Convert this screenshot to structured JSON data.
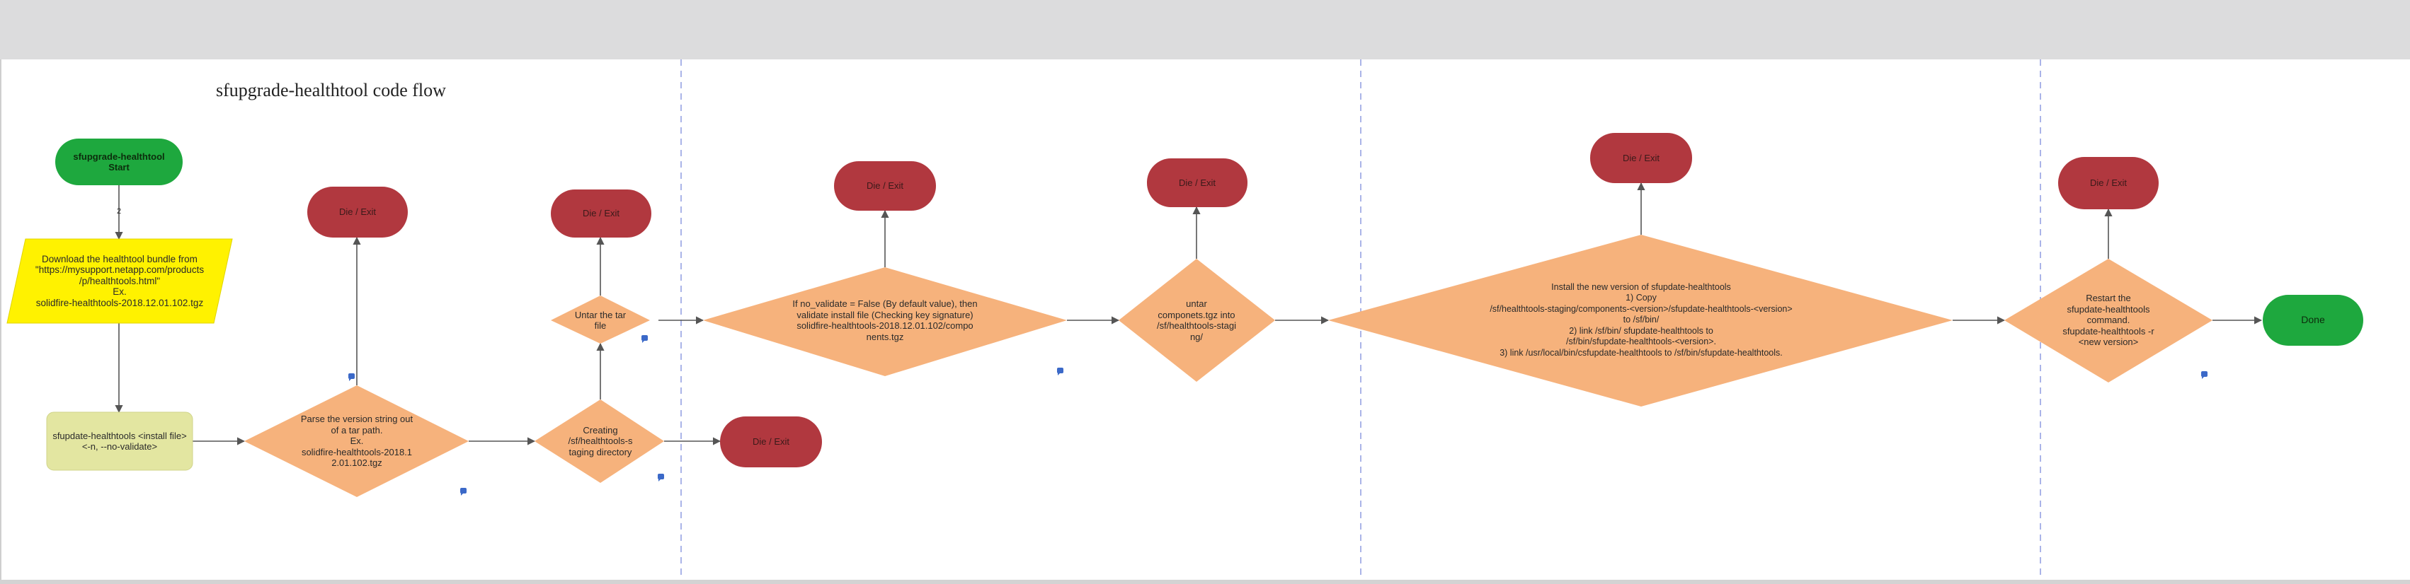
{
  "diagram": {
    "title": "sfupgrade-healthtool code flow",
    "start_label": "sfupgrade-healthtool\nStart",
    "edge_label": "2",
    "download_label": "Download the healthtool bundle from\n\"https://mysupport.netapp.com/products\n/p/healthtools.html\"\nEx.\nsolidfire-healthtools-2018.12.01.102.tgz",
    "install_cmd_label": "sfupdate-healthtools <install file>\n<-n, --no-validate>",
    "parse_label": "Parse the version string out\nof a tar path.\nEx.\nsolidfire-healthtools-2018.1\n2.01.102.tgz",
    "create_dir_label": "Creating\n/sf/healthtools-s\ntaging directory",
    "untar_label": "Untar the tar\nfile",
    "validate_label": "If no_validate = False (By default value), then\nvalidate install file (Checking key signature)\nsolidfire-healthtools-2018.12.01.102/compo\nnents.tgz",
    "untar_components_label": "untar\ncomponets.tgz into\n/sf/healthtools-stagi\nng/",
    "install_label": "Install the new version of sfupdate-healthtools\n1) Copy\n/sf/healthtools-staging/components-<version>/sfupdate-healthtools-<version>\nto /sf/bin/\n2) link /sf/bin/ sfupdate-healthtools to\n/sf/bin/sfupdate-healthtools-<version>.\n3) link /usr/local/bin/csfupdate-healthtools to /sf/bin/sfupdate-healthtools.",
    "restart_label": "Restart the\nsfupdate-healthtools\ncommand.\nsfupdate-healthtools -r\n<new version>",
    "done_label": "Done",
    "exit_label": "Die / Exit",
    "colors": {
      "start_end": "#1ea83e",
      "exit": "#b1383f",
      "decision": "#f6b27c",
      "download": "#fff200",
      "command": "#e3e6a1",
      "swimlane": "#8e9ce0",
      "connector": "#555555"
    }
  }
}
